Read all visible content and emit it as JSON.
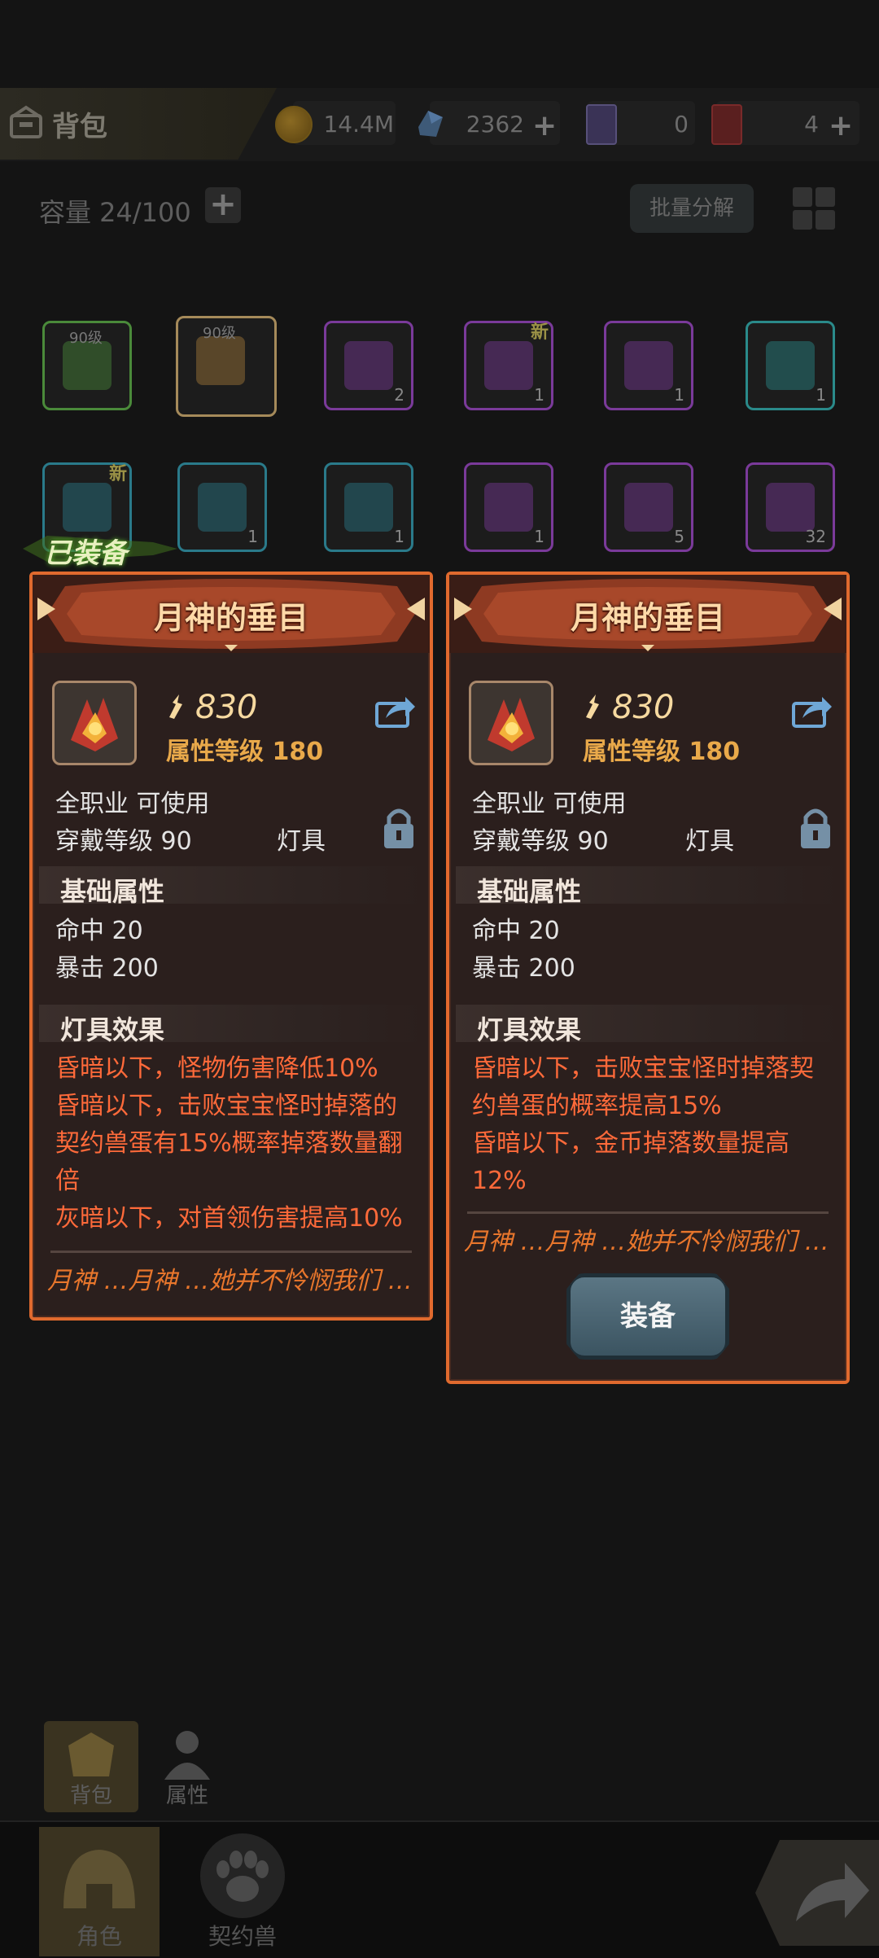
{
  "header": {
    "title": "背包",
    "gold": "14.4M",
    "gems": "2362",
    "card_purple": "0",
    "card_red": "4"
  },
  "inventory": {
    "capacity_label": "容量 24/100",
    "batch_decompose": "批量分解",
    "row1": [
      {
        "level": "90级",
        "count": "",
        "new": "",
        "color": "#4a8a3a"
      },
      {
        "level": "90级",
        "count": "",
        "new": "",
        "color": "#a57b3a"
      },
      {
        "level": "",
        "count": "2",
        "new": "",
        "color": "#7a3a9a"
      },
      {
        "level": "",
        "count": "1",
        "new": "新",
        "color": "#7a3a9a"
      },
      {
        "level": "",
        "count": "1",
        "new": "",
        "color": "#7a3a9a"
      },
      {
        "level": "",
        "count": "1",
        "new": "",
        "color": "#2a8a8a"
      }
    ],
    "row2": [
      {
        "count": "",
        "new": "新",
        "color": "#2a7a8a"
      },
      {
        "count": "1",
        "new": "",
        "color": "#2a7a8a"
      },
      {
        "count": "1",
        "new": "",
        "color": "#2a7a8a"
      },
      {
        "count": "1",
        "new": "",
        "color": "#7a3a9a"
      },
      {
        "count": "5",
        "new": "",
        "color": "#7a3a9a"
      },
      {
        "count": "32",
        "new": "",
        "color": "#7a3a9a"
      }
    ]
  },
  "equipped_tag": "已装备",
  "panel_left": {
    "name": "月神的垂目",
    "power": "830",
    "attr_level": "属性等级 180",
    "class_req": "全职业 可使用",
    "wear_level": "穿戴等级 90",
    "slot_type": "灯具",
    "base_header": "基础属性",
    "stat1": "命中  20",
    "stat2": "暴击  200",
    "effect_header": "灯具效果",
    "effects": [
      "昏暗以下，怪物伤害降低10%",
      "昏暗以下，击败宝宝怪时掉落的",
      "契约兽蛋有15%概率掉落数量翻",
      "倍",
      "灰暗以下，对首领伤害提高10%"
    ],
    "flavor": "月神 …月神 …她并不怜悯我们 …"
  },
  "panel_right": {
    "name": "月神的垂目",
    "power": "830",
    "attr_level": "属性等级 180",
    "class_req": "全职业 可使用",
    "wear_level": "穿戴等级 90",
    "slot_type": "灯具",
    "base_header": "基础属性",
    "stat1": "命中  20",
    "stat2": "暴击  200",
    "effect_header": "灯具效果",
    "effects": [
      "昏暗以下，击败宝宝怪时掉落契",
      "约兽蛋的概率提高15%",
      "昏暗以下，金币掉落数量提高",
      "12%"
    ],
    "flavor": "月神 …月神 …她并不怜悯我们 …",
    "equip_button": "装备"
  },
  "subtabs": {
    "bag": "背包",
    "attributes": "属性"
  },
  "nav": {
    "character": "角色",
    "pet": "契约兽"
  }
}
